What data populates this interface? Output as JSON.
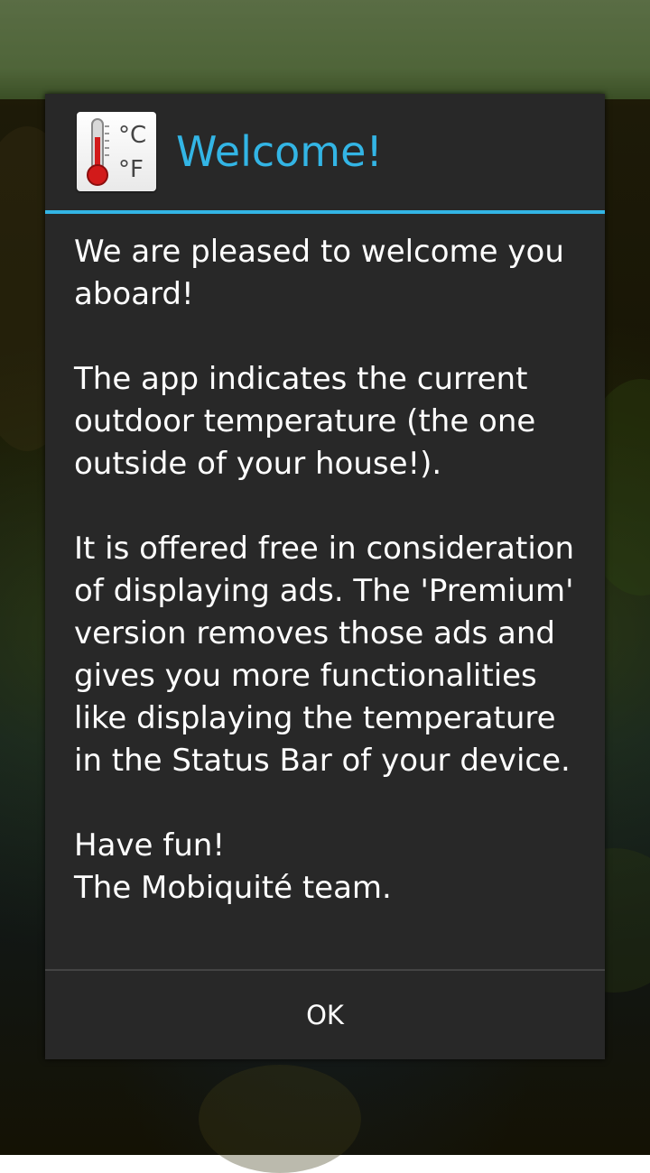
{
  "dialog": {
    "title": "Welcome!",
    "icon": "thermometer-celsius-fahrenheit-icon",
    "message": "We are pleased to welcome you aboard!\n\nThe app indicates the current outdoor temperature (the one outside of your house!).\n\nIt is offered free in consideration of displaying ads. The 'Premium' version removes those ads and gives you more functionalities like displaying the temperature in the Status Bar of your device.\n\nHave fun!\nThe Mobiquité team.",
    "ok_label": "OK",
    "icon_text": {
      "celsius": "°C",
      "fahrenheit": "°F"
    }
  },
  "colors": {
    "accent": "#33b5e5",
    "dialog_background": "#282828",
    "text": "#ffffff"
  }
}
